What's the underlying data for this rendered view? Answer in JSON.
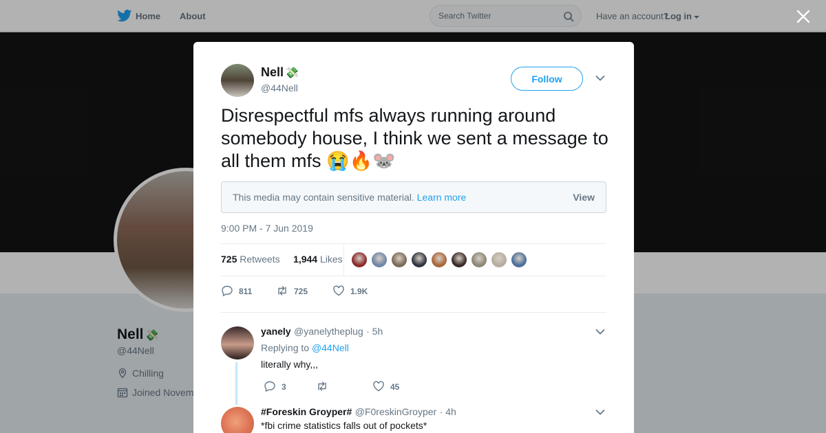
{
  "nav": {
    "home": "Home",
    "about": "About",
    "search_placeholder": "Search Twitter",
    "have_account": "Have an account?",
    "login": "Log in"
  },
  "profile": {
    "name": "Nell",
    "name_emoji": "💸",
    "handle": "@44Nell",
    "location": "Chilling",
    "joined": "Joined Novem"
  },
  "tweet": {
    "author_name": "Nell",
    "author_emoji": "💸",
    "author_handle": "@44Nell",
    "follow_label": "Follow",
    "text": "Disrespectful mfs always running around somebody house, I think we sent a message to all them mfs 😭🔥🐭",
    "sensitive_text": "This media may contain sensitive material.",
    "learn_more": "Learn more",
    "view_label": "View",
    "timestamp": "9:00 PM - 7 Jun 2019",
    "retweets_count": "725",
    "retweets_label": "Retweets",
    "likes_count": "1,944",
    "likes_label": "Likes",
    "reply_count": "811",
    "retweet_count": "725",
    "like_count": "1.9K"
  },
  "likers": [
    "#8a2b2b",
    "#6f86a8",
    "#7a6a58",
    "#2f3440",
    "#a8663a",
    "#3a2a2a",
    "#8d8778",
    "#b5ada0",
    "#4a6f9a"
  ],
  "replies": [
    {
      "name": "yanely",
      "handle": "@yanelytheplug",
      "time": "· 5h",
      "replying_to_prefix": "Replying to",
      "replying_to": "@44Nell",
      "text": "literally why,,,",
      "reply_count": "3",
      "retweet_count": "",
      "like_count": "45"
    },
    {
      "name": "#Foreskin Groyper#",
      "handle": "@F0reskinGroyper",
      "time": "· 4h",
      "text": "*fbi crime statistics falls out of pockets*"
    }
  ]
}
